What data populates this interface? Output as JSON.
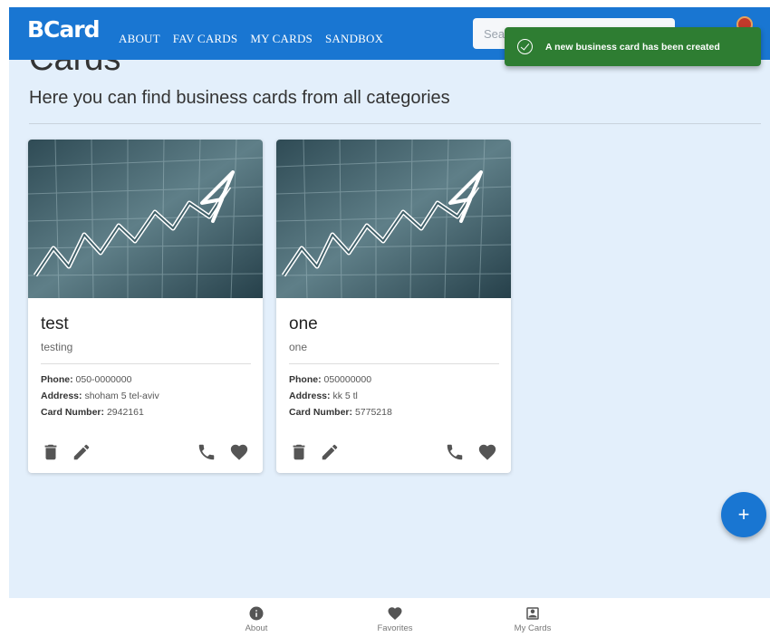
{
  "header": {
    "logo": "BCard",
    "nav": [
      "ABOUT",
      "FAV CARDS",
      "MY CARDS",
      "SANDBOX"
    ],
    "search_placeholder": "Search"
  },
  "snackbar": {
    "message": "A new business card has been created"
  },
  "page": {
    "title": "Cards",
    "subtitle": "Here you can find business cards from all categories"
  },
  "cards": [
    {
      "title": "test",
      "subtitle": "testing",
      "phone_label": "Phone:",
      "phone": "050-0000000",
      "address_label": "Address:",
      "address": "shoham 5 tel-aviv",
      "card_number_label": "Card Number:",
      "card_number": "2942161"
    },
    {
      "title": "one",
      "subtitle": "one",
      "phone_label": "Phone:",
      "phone": "050000000",
      "address_label": "Address:",
      "address": "kk 5 tl",
      "card_number_label": "Card Number:",
      "card_number": "5775218"
    }
  ],
  "fab": {
    "label": "+"
  },
  "bottom_nav": [
    {
      "label": "About",
      "icon": "info-icon"
    },
    {
      "label": "Favorites",
      "icon": "heart-icon"
    },
    {
      "label": "My Cards",
      "icon": "contact-card-icon"
    }
  ],
  "colors": {
    "primary": "#1976d2",
    "page_background": "#e3effb",
    "snackbar_success": "#2e7d32"
  }
}
